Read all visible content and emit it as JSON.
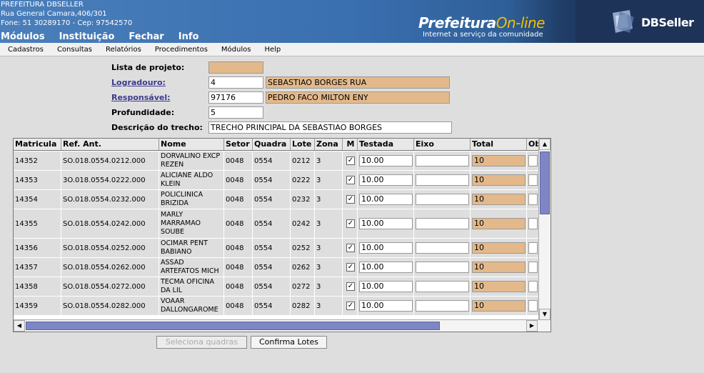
{
  "header": {
    "org_name": "PREFEITURA DBSELLER",
    "address": "Rua General Camara,406/301",
    "phone": "Fone: 51 30289170  -  Cep: 97542570",
    "nav": [
      "Módulos",
      "Instituição",
      "Fechar",
      "Info"
    ],
    "brand_main": "Prefeitura",
    "brand_accent": "On-line",
    "brand_tagline": "Internet a serviço da comunidade",
    "db_logo_text": "DBSeller"
  },
  "menu": [
    "Cadastros",
    "Consultas",
    "Relatórios",
    "Procedimentos",
    "Módulos",
    "Help"
  ],
  "form": {
    "lista_label": "Lista de projeto:",
    "lista_value": "",
    "logradouro_label": "Logradouro:",
    "logradouro_code": "4",
    "logradouro_name": "SEBASTIAO BORGES RUA",
    "responsavel_label": "Responsável:",
    "responsavel_code": "97176",
    "responsavel_name": "PEDRO FACO MILTON ENY",
    "profundidade_label": "Profundidade:",
    "profundidade_value": "5",
    "descricao_label": "Descrição do trecho:",
    "descricao_value": "TRECHO PRINCIPAL DA SEBASTIAO BORGES"
  },
  "table": {
    "columns": [
      "Matricula",
      "Ref. Ant.",
      "Nome",
      "Setor",
      "Quadra",
      "Lote",
      "Zona",
      "M",
      "Testada",
      "Eixo",
      "Total",
      "Ob"
    ],
    "rows": [
      {
        "matricula": "14352",
        "ref": "SO.018.0554.0212.000",
        "nome": "DORVALINO EXCP REZEN",
        "setor": "0048",
        "quadra": "0554",
        "lote": "0212",
        "zona": "3",
        "checked": "✓",
        "testada": "10.00",
        "eixo": "",
        "total": "10"
      },
      {
        "matricula": "14353",
        "ref": "3O.018.0554.0222.000",
        "nome": "ALICIANE ALDO KLEIN",
        "setor": "0048",
        "quadra": "0554",
        "lote": "0222",
        "zona": "3",
        "checked": "✓",
        "testada": "10.00",
        "eixo": "",
        "total": "10"
      },
      {
        "matricula": "14354",
        "ref": "SO.018.0554.0232.000",
        "nome": "POLICLINICA BRIZIDA",
        "setor": "0048",
        "quadra": "0554",
        "lote": "0232",
        "zona": "3",
        "checked": "✓",
        "testada": "10.00",
        "eixo": "",
        "total": "10"
      },
      {
        "matricula": "14355",
        "ref": "SO.018.0554.0242.000",
        "nome": "MARLY MARRAMAO SOUBE",
        "setor": "0048",
        "quadra": "0554",
        "lote": "0242",
        "zona": "3",
        "checked": "✓",
        "testada": "10.00",
        "eixo": "",
        "total": "10"
      },
      {
        "matricula": "14356",
        "ref": "SO.018.0554.0252.000",
        "nome": "OCIMAR PENT BABIANO",
        "setor": "0048",
        "quadra": "0554",
        "lote": "0252",
        "zona": "3",
        "checked": "✓",
        "testada": "10.00",
        "eixo": "",
        "total": "10"
      },
      {
        "matricula": "14357",
        "ref": "SO.018.0554.0262.000",
        "nome": "ASSAD ARTEFATOS MICH",
        "setor": "0048",
        "quadra": "0554",
        "lote": "0262",
        "zona": "3",
        "checked": "✓",
        "testada": "10.00",
        "eixo": "",
        "total": "10"
      },
      {
        "matricula": "14358",
        "ref": "SO.018.0554.0272.000",
        "nome": "TECMA OFICINA DA LIL",
        "setor": "0048",
        "quadra": "0554",
        "lote": "0272",
        "zona": "3",
        "checked": "✓",
        "testada": "10.00",
        "eixo": "",
        "total": "10"
      },
      {
        "matricula": "14359",
        "ref": "SO.018.0554.0282.000",
        "nome": "VOAAR DALLONGAROME",
        "setor": "0048",
        "quadra": "0554",
        "lote": "0282",
        "zona": "3",
        "checked": "✓",
        "testada": "10.00",
        "eixo": "",
        "total": "10"
      }
    ]
  },
  "buttons": {
    "seleciona": "Seleciona quadras",
    "confirma": "Confirma Lotes"
  },
  "icons": {
    "scroll_up": "arrow-up-icon",
    "scroll_down": "arrow-down-icon",
    "scroll_left": "arrow-left-icon",
    "scroll_right": "arrow-right-icon",
    "check": "check-icon",
    "logo": "dbseller-logo-icon"
  },
  "colors": {
    "header_blue": "#4a7fbb",
    "readonly_field": "#e3b98b",
    "scroll_thumb": "#7f86c6",
    "link": "#3b3b8c"
  }
}
